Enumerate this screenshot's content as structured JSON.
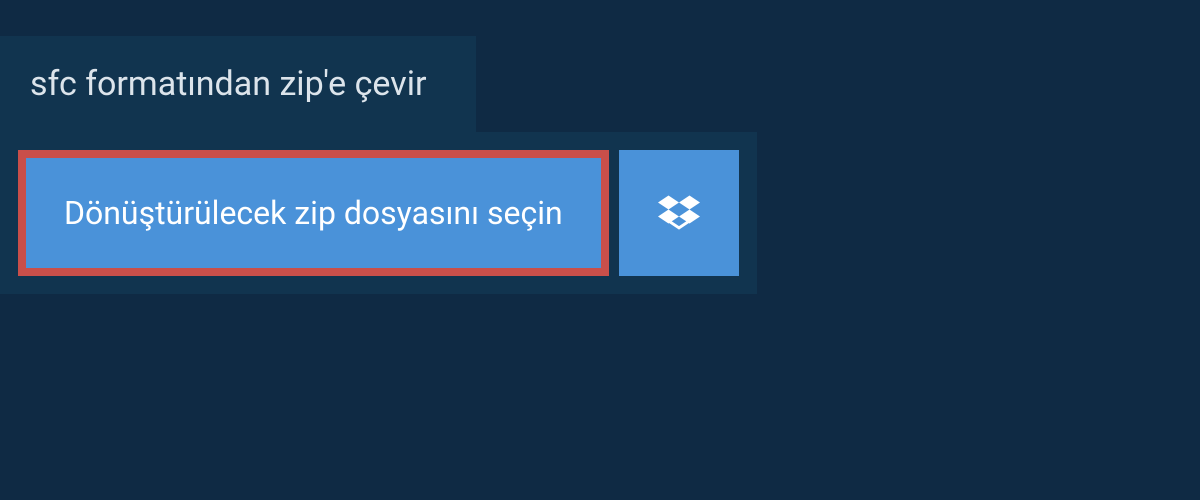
{
  "header": {
    "title": "sfc formatından zip'e çevir"
  },
  "actions": {
    "select_file_label": "Dönüştürülecek zip dosyasını seçin"
  },
  "colors": {
    "page_bg": "#0f2a44",
    "panel_bg": "#11344f",
    "button_bg": "#4a92d9",
    "highlight_border": "#c94f4a"
  },
  "icons": {
    "dropbox": "dropbox-icon"
  }
}
